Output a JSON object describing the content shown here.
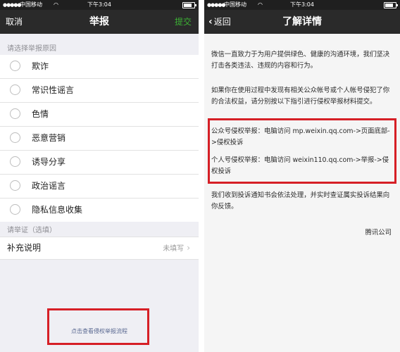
{
  "status_bar": {
    "signal": "●●●●●",
    "carrier": "中国移动",
    "time": "下午3:04"
  },
  "left_screen": {
    "nav": {
      "cancel": "取消",
      "title": "举报",
      "submit": "提交"
    },
    "reason_section_label": "请选择举报原因",
    "reasons": [
      "欺诈",
      "常识性谣言",
      "色情",
      "恶意营销",
      "诱导分享",
      "政治谣言",
      "隐私信息收集"
    ],
    "evidence_section_label": "请举证（选填）",
    "supplement": {
      "label": "补充说明",
      "value": "未填写"
    },
    "infringement_link": "点击查看侵权举报流程"
  },
  "right_screen": {
    "nav": {
      "back": "返回",
      "title": "了解详情"
    },
    "paragraphs": [
      "微信一直致力于为用户提供绿色、健康的沟通环境，我们坚决打击各类违法、违规的内容和行为。",
      "如果你在使用过程中发现有相关公众帐号或个人帐号侵犯了你的合法权益，请分别按以下指引进行侵权举报材料提交。",
      "公众号侵权举报：电脑访问 mp.weixin.qq.com->页面底部->侵权投诉",
      "个人号侵权举报：电脑访问 weixin110.qq.com->举报->侵权投诉",
      "我们收到投诉通知书会依法处理，并实时查证属实投诉结果向你反馈。"
    ],
    "signature": "腾讯公司"
  },
  "colors": {
    "nav_bg": "#2a2a2a",
    "accent_green": "#3cb034",
    "highlight_red": "#d61f26",
    "page_bg": "#efeff4"
  }
}
